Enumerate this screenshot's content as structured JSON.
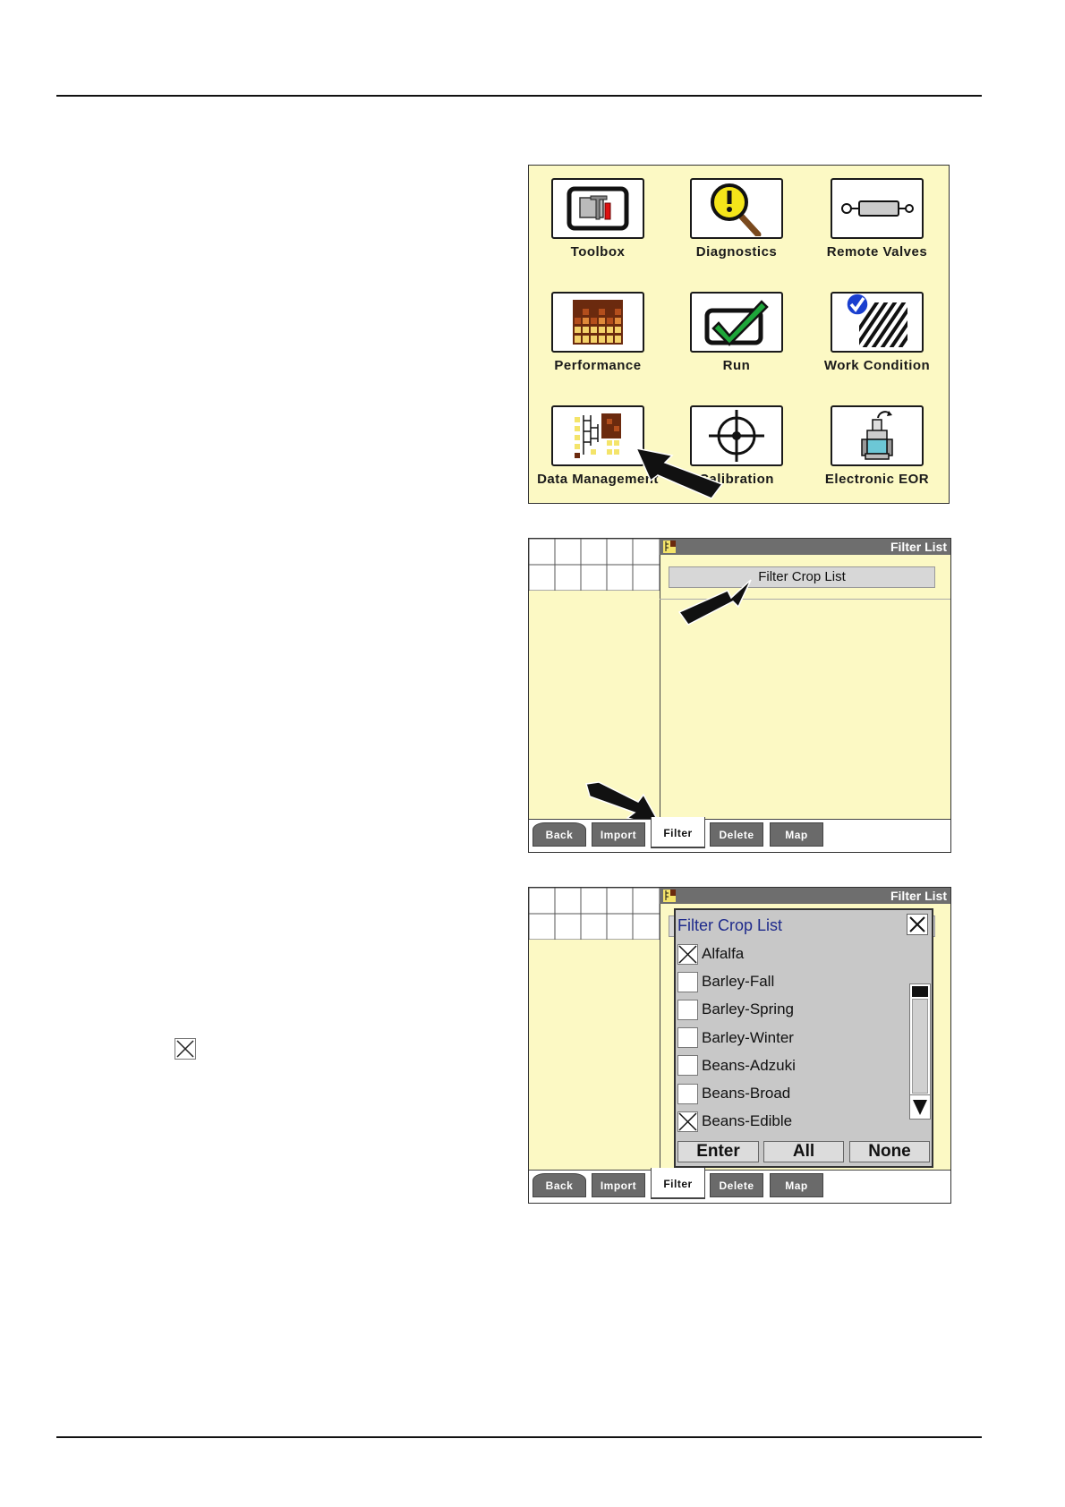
{
  "menu": {
    "tiles": [
      {
        "label": "Toolbox",
        "icon": "toolbox-icon"
      },
      {
        "label": "Diagnostics",
        "icon": "diagnostics-icon"
      },
      {
        "label": "Remote Valves",
        "icon": "remote-valves-icon"
      },
      {
        "label": "Performance",
        "icon": "performance-icon"
      },
      {
        "label": "Run",
        "icon": "run-icon"
      },
      {
        "label": "Work Condition",
        "icon": "work-condition-icon"
      },
      {
        "label": "Data Management",
        "icon": "data-management-icon"
      },
      {
        "label": "Calibration",
        "icon": "calibration-icon"
      },
      {
        "label": "Electronic EOR",
        "icon": "electronic-eor-icon"
      }
    ]
  },
  "filter_screen": {
    "title": "Filter List",
    "crop_button": "Filter Crop List",
    "softkeys": [
      {
        "label": "Back"
      },
      {
        "label": "Import"
      },
      {
        "label": "Filter",
        "active": true
      },
      {
        "label": "Delete"
      },
      {
        "label": "Map"
      }
    ]
  },
  "dialog": {
    "title": "Filter Crop List",
    "crops": [
      {
        "name": "Alfalfa",
        "checked": true
      },
      {
        "name": "Barley-Fall",
        "checked": false
      },
      {
        "name": "Barley-Spring",
        "checked": false
      },
      {
        "name": "Barley-Winter",
        "checked": false
      },
      {
        "name": "Beans-Adzuki",
        "checked": false
      },
      {
        "name": "Beans-Broad",
        "checked": false
      },
      {
        "name": "Beans-Edible",
        "checked": true
      }
    ],
    "buttons": {
      "enter": "Enter",
      "all": "All",
      "none": "None"
    }
  },
  "colors": {
    "screen_bg": "#fcf9c4",
    "titlebar": "#6e6e6e",
    "softkey": "#6a6a6a",
    "dialog_title": "#1f2b8c"
  }
}
